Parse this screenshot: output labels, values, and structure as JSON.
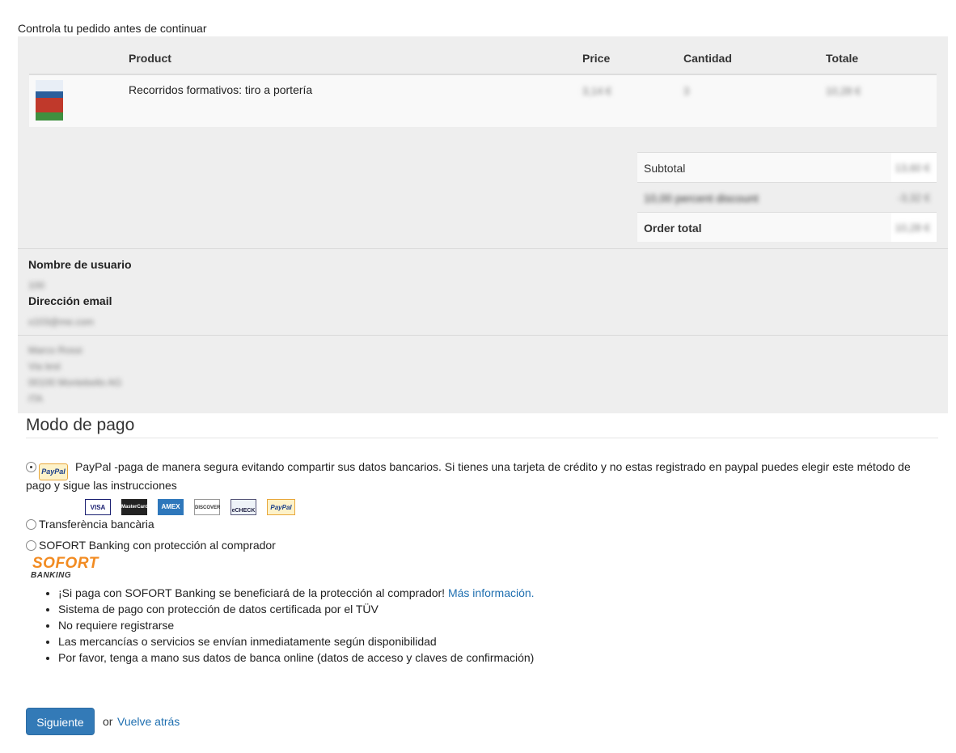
{
  "intro": "Controla tu pedido antes de continuar",
  "table": {
    "headers": {
      "product": "Product",
      "price": "Price",
      "quantity": "Cantidad",
      "total": "Totale"
    },
    "rows": [
      {
        "name": "Recorridos formativos: tiro a portería",
        "price": "3,14 €",
        "qty": "3",
        "total": "10,28 €"
      }
    ]
  },
  "totals": {
    "subtotal_label": "Subtotal",
    "subtotal_value": "13,60 €",
    "discount_label": "10,00 percent discount",
    "discount_value": "-3,32 €",
    "order_total_label": "Order total",
    "order_total_value": "10,28 €"
  },
  "account": {
    "username_label": "Nombre de usuario",
    "username_value": "100",
    "email_label": "Dirección email",
    "email_value": "x103@me.com"
  },
  "address_lines": [
    "Marco Rossi",
    "Via test",
    "00100 Montebello AG",
    "ITA"
  ],
  "payment": {
    "heading": "Modo de pago",
    "paypal_badge": "PayPal",
    "paypal_text": "PayPal -paga de manera segura evitando compartir sus datos bancarios. Si tienes una tarjeta de crédito y no estas registrado en paypal puedes elegir este método de pago y sigue las instrucciones",
    "cards": [
      "VISA",
      "MasterCard",
      "AMEX",
      "DISCOVER",
      "eCHECK",
      "PayPal"
    ],
    "transfer_label": "Transferència bancària",
    "sofort_label": "SOFORT Banking con protección al comprador",
    "sofort_logo_top": "SOFORT",
    "sofort_logo_bottom": "BANKING",
    "sofort_bullet1_text": "¡Si paga con SOFORT Banking se beneficiará de la protección al comprador!",
    "sofort_bullet1_link": "Más información.",
    "sofort_bullets": [
      "Sistema de pago con protección de datos certificada por el TÜV",
      "No requiere registrarse",
      "Las mercancías o servicios se envían inmediatamente según disponibilidad",
      "Por favor, tenga a mano sus datos de banca online (datos de acceso y claves de confirmación)"
    ]
  },
  "actions": {
    "next": "Siguiente",
    "or": "or",
    "back": "Vuelve atrás"
  },
  "colors": {
    "primary": "#337ab7",
    "link": "#1f6fb0",
    "panel": "#eeeeee",
    "sofort_orange": "#f28b21"
  }
}
